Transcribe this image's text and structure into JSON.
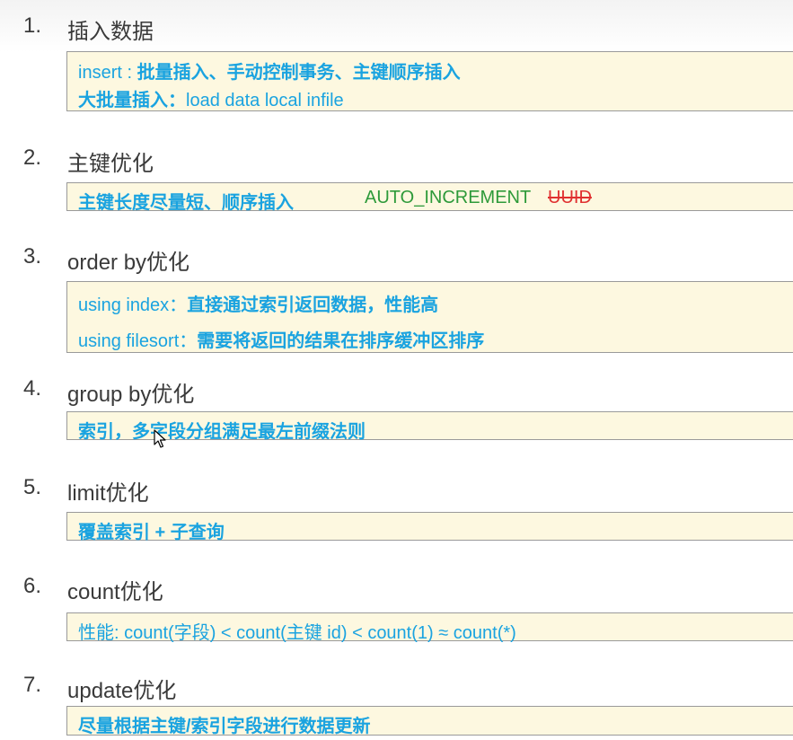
{
  "sections": [
    {
      "num": "1.",
      "title": "插入数据",
      "lines": [
        {
          "prefix": "insert : ",
          "rest": "批量插入、手动控制事务、主键顺序插入"
        },
        {
          "prefix": "大批量插入：",
          "rest": "load  data  local  infile"
        }
      ]
    },
    {
      "num": "2.",
      "title": "主键优化",
      "lines": [
        {
          "text": "主键长度尽量短、顺序插入",
          "green": "AUTO_INCREMENT",
          "strike": "UUID"
        }
      ]
    },
    {
      "num": "3.",
      "title": "order by优化",
      "lines": [
        {
          "prefix": "using index：",
          "rest": "直接通过索引返回数据，性能高"
        },
        {
          "prefix": "using filesort：",
          "rest": "需要将返回的结果在排序缓冲区排序"
        }
      ]
    },
    {
      "num": "4.",
      "title": "group by优化",
      "lines": [
        {
          "text": "索引，多字段分组满足最左前缀法则"
        }
      ]
    },
    {
      "num": "5.",
      "title": "limit优化",
      "lines": [
        {
          "text": "覆盖索引 + 子查询"
        }
      ]
    },
    {
      "num": "6.",
      "title": "count优化",
      "lines": [
        {
          "text": "性能: count(字段) < count(主键 id) < count(1) ≈ count(*)"
        }
      ]
    },
    {
      "num": "7.",
      "title": "update优化",
      "lines": [
        {
          "text": "尽量根据主键/索引字段进行数据更新"
        }
      ]
    }
  ]
}
